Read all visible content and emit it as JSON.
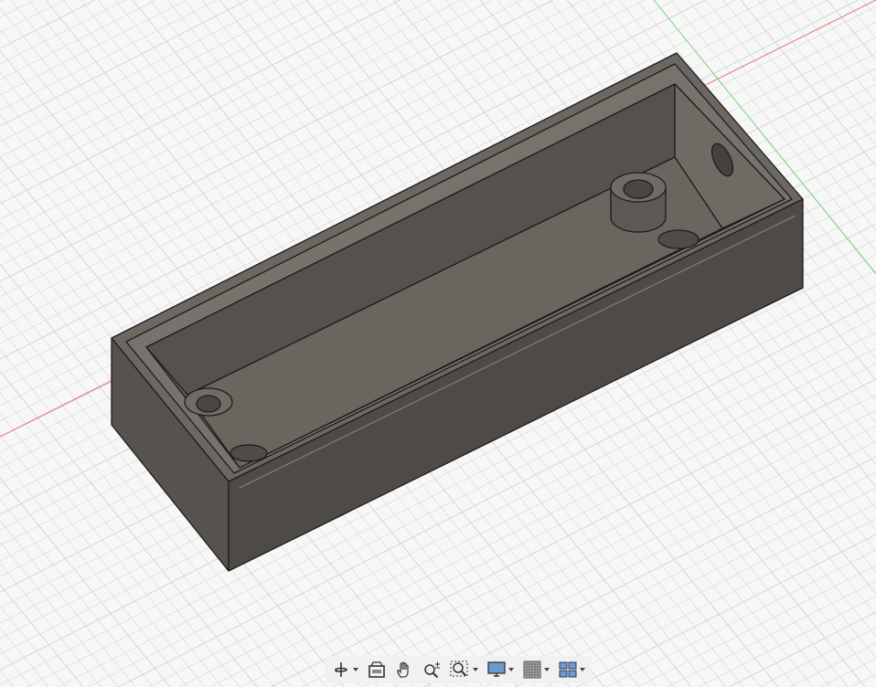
{
  "viewport": {
    "background": "#f7f7f7",
    "grid_color": "#d6d6d6",
    "x_axis_color": "#e57373",
    "y_axis_color": "#7ed87e",
    "model_color": "#5a5650"
  },
  "toolbar": {
    "items": [
      {
        "icon": "orbit-icon",
        "has_dropdown": true
      },
      {
        "icon": "look-at-icon",
        "has_dropdown": false
      },
      {
        "icon": "pan-hand-icon",
        "has_dropdown": false
      },
      {
        "icon": "zoom-icon",
        "has_dropdown": false
      },
      {
        "icon": "fit-window-icon",
        "has_dropdown": true
      },
      {
        "icon": "display-settings-icon",
        "has_dropdown": true
      },
      {
        "icon": "grid-snaps-icon",
        "has_dropdown": true
      },
      {
        "icon": "viewports-icon",
        "has_dropdown": true
      }
    ]
  }
}
